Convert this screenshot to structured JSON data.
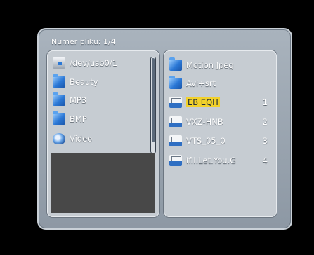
{
  "dialog": {
    "title": "Numer pliku: 1/4"
  },
  "left_panel": {
    "items": [
      {
        "label": "/dev/usb0/1",
        "icon": "usb-drive-icon"
      },
      {
        "label": "Beauty",
        "icon": "folder-icon"
      },
      {
        "label": "MP3",
        "icon": "folder-icon"
      },
      {
        "label": "BMP",
        "icon": "folder-icon"
      },
      {
        "label": "Video",
        "icon": "disc-icon"
      }
    ]
  },
  "right_panel": {
    "items": [
      {
        "label": "Motion Jpeg",
        "icon": "folder-icon",
        "number": ""
      },
      {
        "label": "Avi+srt",
        "icon": "folder-icon",
        "number": ""
      },
      {
        "label": "EB EQH",
        "icon": "video-file-icon",
        "number": "1",
        "selected": true
      },
      {
        "label": "VXZ-HNB",
        "icon": "video-file-icon",
        "number": "2"
      },
      {
        "label": "VTS_05_0",
        "icon": "video-file-icon",
        "number": "3"
      },
      {
        "label": "If.I.Let.You.G",
        "icon": "video-file-icon",
        "number": "4"
      }
    ]
  },
  "colors": {
    "background": "#000000",
    "panel": "#c6ccd2",
    "highlight": "#f2d12b",
    "folder_blue": "#2b78d6"
  }
}
